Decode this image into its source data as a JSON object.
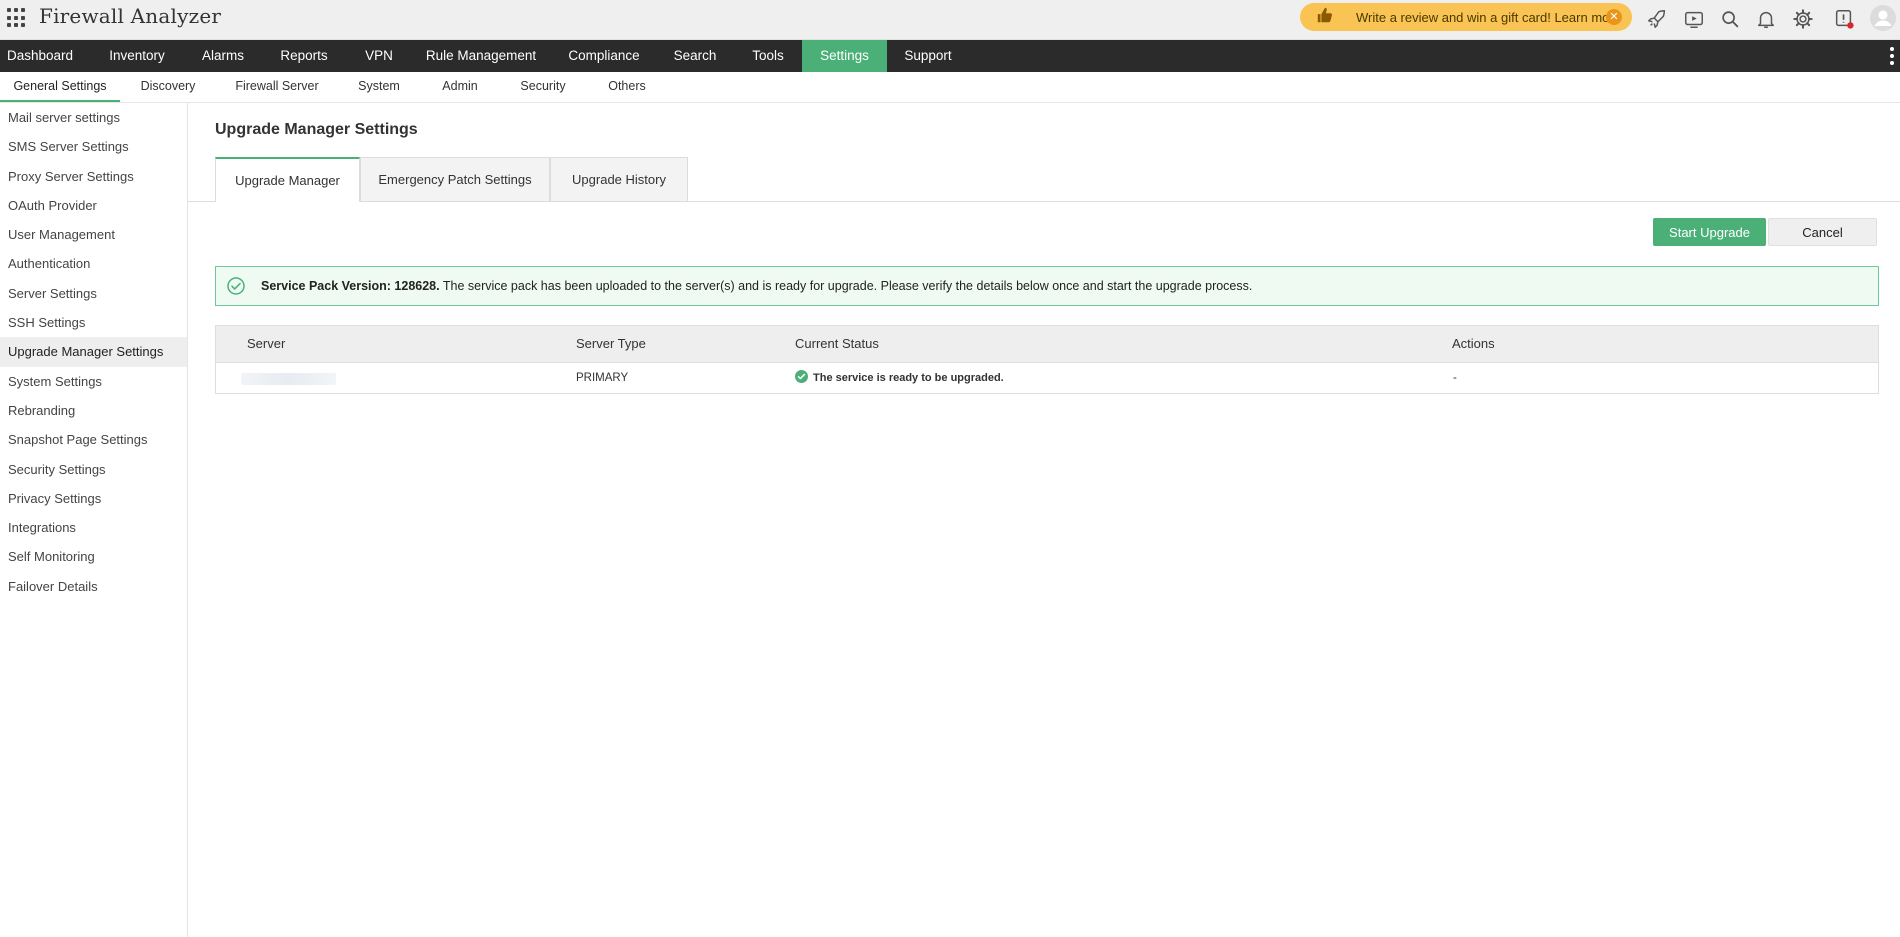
{
  "header": {
    "app_title": "Firewall Analyzer",
    "promo_text": "Write a review and win a gift card! Learn more",
    "icons": [
      "apps-grid-icon",
      "thumbs-up-icon",
      "close-icon",
      "rocket-icon",
      "video-icon",
      "search-icon",
      "bell-icon",
      "gear-icon",
      "alert-shield-icon",
      "user-avatar-icon"
    ]
  },
  "mainnav": {
    "items": [
      "Dashboard",
      "Inventory",
      "Alarms",
      "Reports",
      "VPN",
      "Rule Management",
      "Compliance",
      "Search",
      "Tools",
      "Settings",
      "Support"
    ],
    "active": "Settings",
    "active_color": "#4bb077"
  },
  "subnav": {
    "items": [
      "General Settings",
      "Discovery",
      "Firewall Server",
      "System",
      "Admin",
      "Security",
      "Others"
    ],
    "active": "General Settings"
  },
  "sidebar": {
    "items": [
      "Mail server settings",
      "SMS Server Settings",
      "Proxy Server Settings",
      "OAuth Provider",
      "User Management",
      "Authentication",
      "Server Settings",
      "SSH Settings",
      "Upgrade Manager Settings",
      "System Settings",
      "Rebranding",
      "Snapshot Page Settings",
      "Security Settings",
      "Privacy Settings",
      "Integrations",
      "Self Monitoring",
      "Failover Details"
    ],
    "active": "Upgrade Manager Settings"
  },
  "main": {
    "title": "Upgrade Manager Settings",
    "tabs": [
      "Upgrade Manager",
      "Emergency Patch Settings",
      "Upgrade History"
    ],
    "active_tab": "Upgrade Manager",
    "start_button": "Start Upgrade",
    "cancel_button": "Cancel",
    "alert": {
      "bold": "Service Pack Version: 128628.",
      "text": " The service pack has been uploaded to the server(s) and is ready for upgrade. Please verify the details below once and start the upgrade process."
    },
    "table": {
      "columns": [
        "Server",
        "Server Type",
        "Current Status",
        "Actions"
      ],
      "rows": [
        {
          "server": "",
          "type": "PRIMARY",
          "status": "The service is ready to be upgraded.",
          "actions": "-"
        }
      ]
    }
  }
}
